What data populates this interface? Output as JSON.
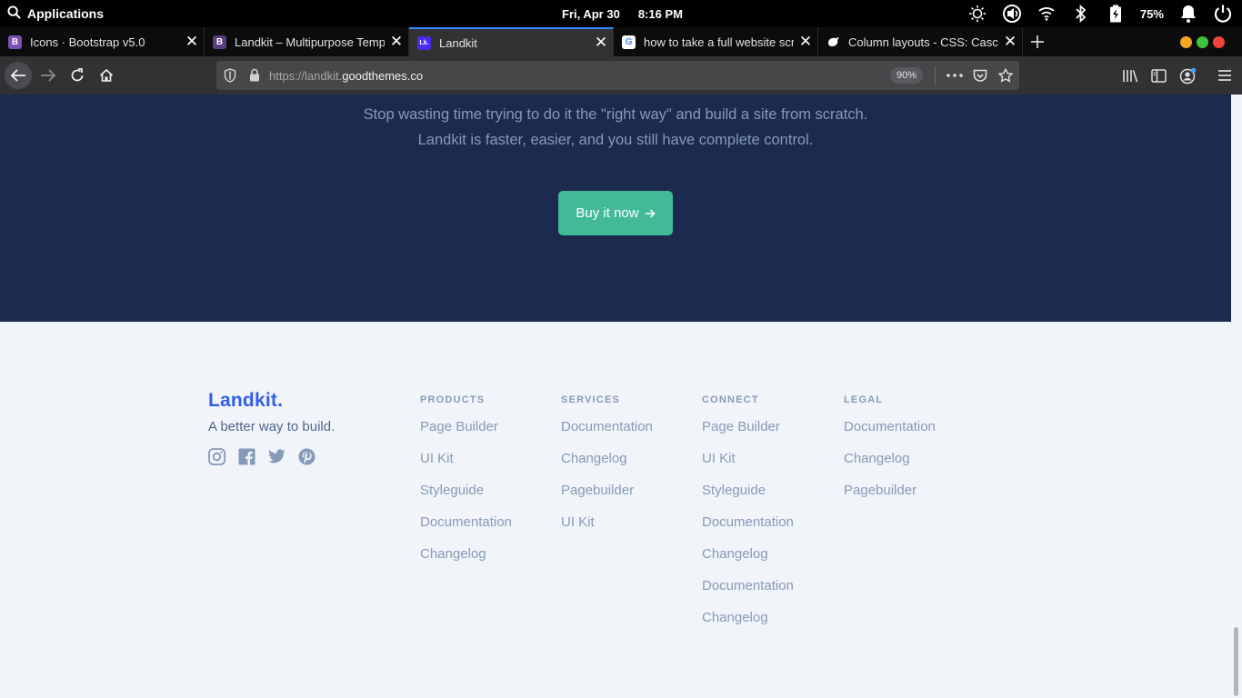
{
  "system": {
    "apps_label": "Applications",
    "date": "Fri, Apr 30",
    "time": "8:16 PM",
    "battery": "75%"
  },
  "tabs": [
    {
      "title": "Icons · Bootstrap v5.0",
      "favicon": "B",
      "favicon_color": "#7952b3"
    },
    {
      "title": "Landkit – Multipurpose Temp",
      "favicon": "B",
      "favicon_color": "#563d7c"
    },
    {
      "title": "Landkit",
      "favicon": "Lk.",
      "favicon_color": "#4a2cf0"
    },
    {
      "title": "how to take a full website scr",
      "favicon": "G",
      "favicon_color": "#ffffff"
    },
    {
      "title": "Column layouts - CSS: Cascad",
      "favicon": "",
      "favicon_color": "#000000"
    }
  ],
  "navbar": {
    "url_prefix": "https://landkit.",
    "url_host": "goodthemes.co",
    "zoom": "90%"
  },
  "hero": {
    "line1": "Stop wasting time trying to do it the \"right way\" and build a site from scratch.",
    "line2": "Landkit is faster, easier, and you still have complete control.",
    "button_label": "Buy it now"
  },
  "footer": {
    "brand": "Landkit.",
    "tagline": "A better way to build.",
    "social_icons": [
      "instagram-icon",
      "facebook-icon",
      "twitter-icon",
      "pinterest-icon"
    ],
    "columns": [
      {
        "heading": "PRODUCTS",
        "links": [
          "Page Builder",
          "UI Kit",
          "Styleguide",
          "Documentation",
          "Changelog"
        ]
      },
      {
        "heading": "SERVICES",
        "links": [
          "Documentation",
          "Changelog",
          "Pagebuilder",
          "UI Kit"
        ]
      },
      {
        "heading": "CONNECT",
        "links": [
          "Page Builder",
          "UI Kit",
          "Styleguide",
          "Documentation",
          "Changelog",
          "Documentation",
          "Changelog"
        ]
      },
      {
        "heading": "LEGAL",
        "links": [
          "Documentation",
          "Changelog",
          "Pagebuilder"
        ]
      }
    ]
  },
  "colors": {
    "hero_bg": "#1b2a4e",
    "accent": "#335eea",
    "button": "#42ba96",
    "muted": "#869ab8"
  }
}
